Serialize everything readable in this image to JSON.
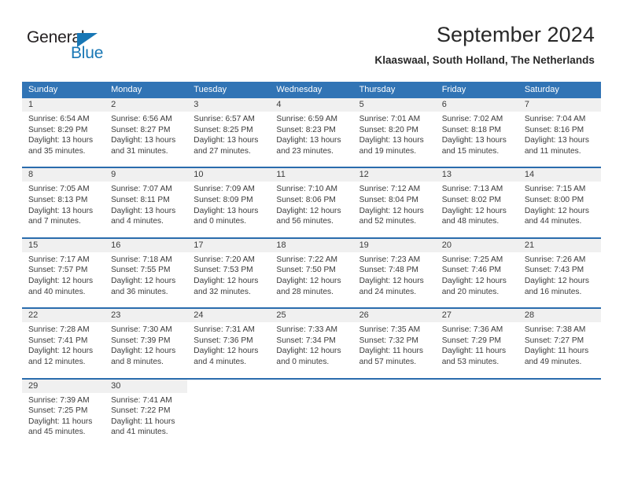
{
  "logo": {
    "word_top": "General",
    "word_bottom": "Blue",
    "triangle_icon": "triangle-icon",
    "color_dark": "#231f20",
    "color_blue": "#1877b5"
  },
  "header": {
    "title": "September 2024",
    "subtitle": "Klaaswaal, South Holland, The Netherlands"
  },
  "theme": {
    "header_blue": "#3174b5",
    "rule_blue": "#2a6cad",
    "daynum_band": "#f0f0f0",
    "text": "#3b3b3b"
  },
  "weekdays": [
    "Sunday",
    "Monday",
    "Tuesday",
    "Wednesday",
    "Thursday",
    "Friday",
    "Saturday"
  ],
  "weeks": [
    [
      {
        "day": "1",
        "lines": [
          "Sunrise: 6:54 AM",
          "Sunset: 8:29 PM",
          "Daylight: 13 hours",
          "and 35 minutes."
        ]
      },
      {
        "day": "2",
        "lines": [
          "Sunrise: 6:56 AM",
          "Sunset: 8:27 PM",
          "Daylight: 13 hours",
          "and 31 minutes."
        ]
      },
      {
        "day": "3",
        "lines": [
          "Sunrise: 6:57 AM",
          "Sunset: 8:25 PM",
          "Daylight: 13 hours",
          "and 27 minutes."
        ]
      },
      {
        "day": "4",
        "lines": [
          "Sunrise: 6:59 AM",
          "Sunset: 8:23 PM",
          "Daylight: 13 hours",
          "and 23 minutes."
        ]
      },
      {
        "day": "5",
        "lines": [
          "Sunrise: 7:01 AM",
          "Sunset: 8:20 PM",
          "Daylight: 13 hours",
          "and 19 minutes."
        ]
      },
      {
        "day": "6",
        "lines": [
          "Sunrise: 7:02 AM",
          "Sunset: 8:18 PM",
          "Daylight: 13 hours",
          "and 15 minutes."
        ]
      },
      {
        "day": "7",
        "lines": [
          "Sunrise: 7:04 AM",
          "Sunset: 8:16 PM",
          "Daylight: 13 hours",
          "and 11 minutes."
        ]
      }
    ],
    [
      {
        "day": "8",
        "lines": [
          "Sunrise: 7:05 AM",
          "Sunset: 8:13 PM",
          "Daylight: 13 hours",
          "and 7 minutes."
        ]
      },
      {
        "day": "9",
        "lines": [
          "Sunrise: 7:07 AM",
          "Sunset: 8:11 PM",
          "Daylight: 13 hours",
          "and 4 minutes."
        ]
      },
      {
        "day": "10",
        "lines": [
          "Sunrise: 7:09 AM",
          "Sunset: 8:09 PM",
          "Daylight: 13 hours",
          "and 0 minutes."
        ]
      },
      {
        "day": "11",
        "lines": [
          "Sunrise: 7:10 AM",
          "Sunset: 8:06 PM",
          "Daylight: 12 hours",
          "and 56 minutes."
        ]
      },
      {
        "day": "12",
        "lines": [
          "Sunrise: 7:12 AM",
          "Sunset: 8:04 PM",
          "Daylight: 12 hours",
          "and 52 minutes."
        ]
      },
      {
        "day": "13",
        "lines": [
          "Sunrise: 7:13 AM",
          "Sunset: 8:02 PM",
          "Daylight: 12 hours",
          "and 48 minutes."
        ]
      },
      {
        "day": "14",
        "lines": [
          "Sunrise: 7:15 AM",
          "Sunset: 8:00 PM",
          "Daylight: 12 hours",
          "and 44 minutes."
        ]
      }
    ],
    [
      {
        "day": "15",
        "lines": [
          "Sunrise: 7:17 AM",
          "Sunset: 7:57 PM",
          "Daylight: 12 hours",
          "and 40 minutes."
        ]
      },
      {
        "day": "16",
        "lines": [
          "Sunrise: 7:18 AM",
          "Sunset: 7:55 PM",
          "Daylight: 12 hours",
          "and 36 minutes."
        ]
      },
      {
        "day": "17",
        "lines": [
          "Sunrise: 7:20 AM",
          "Sunset: 7:53 PM",
          "Daylight: 12 hours",
          "and 32 minutes."
        ]
      },
      {
        "day": "18",
        "lines": [
          "Sunrise: 7:22 AM",
          "Sunset: 7:50 PM",
          "Daylight: 12 hours",
          "and 28 minutes."
        ]
      },
      {
        "day": "19",
        "lines": [
          "Sunrise: 7:23 AM",
          "Sunset: 7:48 PM",
          "Daylight: 12 hours",
          "and 24 minutes."
        ]
      },
      {
        "day": "20",
        "lines": [
          "Sunrise: 7:25 AM",
          "Sunset: 7:46 PM",
          "Daylight: 12 hours",
          "and 20 minutes."
        ]
      },
      {
        "day": "21",
        "lines": [
          "Sunrise: 7:26 AM",
          "Sunset: 7:43 PM",
          "Daylight: 12 hours",
          "and 16 minutes."
        ]
      }
    ],
    [
      {
        "day": "22",
        "lines": [
          "Sunrise: 7:28 AM",
          "Sunset: 7:41 PM",
          "Daylight: 12 hours",
          "and 12 minutes."
        ]
      },
      {
        "day": "23",
        "lines": [
          "Sunrise: 7:30 AM",
          "Sunset: 7:39 PM",
          "Daylight: 12 hours",
          "and 8 minutes."
        ]
      },
      {
        "day": "24",
        "lines": [
          "Sunrise: 7:31 AM",
          "Sunset: 7:36 PM",
          "Daylight: 12 hours",
          "and 4 minutes."
        ]
      },
      {
        "day": "25",
        "lines": [
          "Sunrise: 7:33 AM",
          "Sunset: 7:34 PM",
          "Daylight: 12 hours",
          "and 0 minutes."
        ]
      },
      {
        "day": "26",
        "lines": [
          "Sunrise: 7:35 AM",
          "Sunset: 7:32 PM",
          "Daylight: 11 hours",
          "and 57 minutes."
        ]
      },
      {
        "day": "27",
        "lines": [
          "Sunrise: 7:36 AM",
          "Sunset: 7:29 PM",
          "Daylight: 11 hours",
          "and 53 minutes."
        ]
      },
      {
        "day": "28",
        "lines": [
          "Sunrise: 7:38 AM",
          "Sunset: 7:27 PM",
          "Daylight: 11 hours",
          "and 49 minutes."
        ]
      }
    ],
    [
      {
        "day": "29",
        "lines": [
          "Sunrise: 7:39 AM",
          "Sunset: 7:25 PM",
          "Daylight: 11 hours",
          "and 45 minutes."
        ]
      },
      {
        "day": "30",
        "lines": [
          "Sunrise: 7:41 AM",
          "Sunset: 7:22 PM",
          "Daylight: 11 hours",
          "and 41 minutes."
        ]
      },
      {
        "day": "",
        "lines": []
      },
      {
        "day": "",
        "lines": []
      },
      {
        "day": "",
        "lines": []
      },
      {
        "day": "",
        "lines": []
      },
      {
        "day": "",
        "lines": []
      }
    ]
  ]
}
